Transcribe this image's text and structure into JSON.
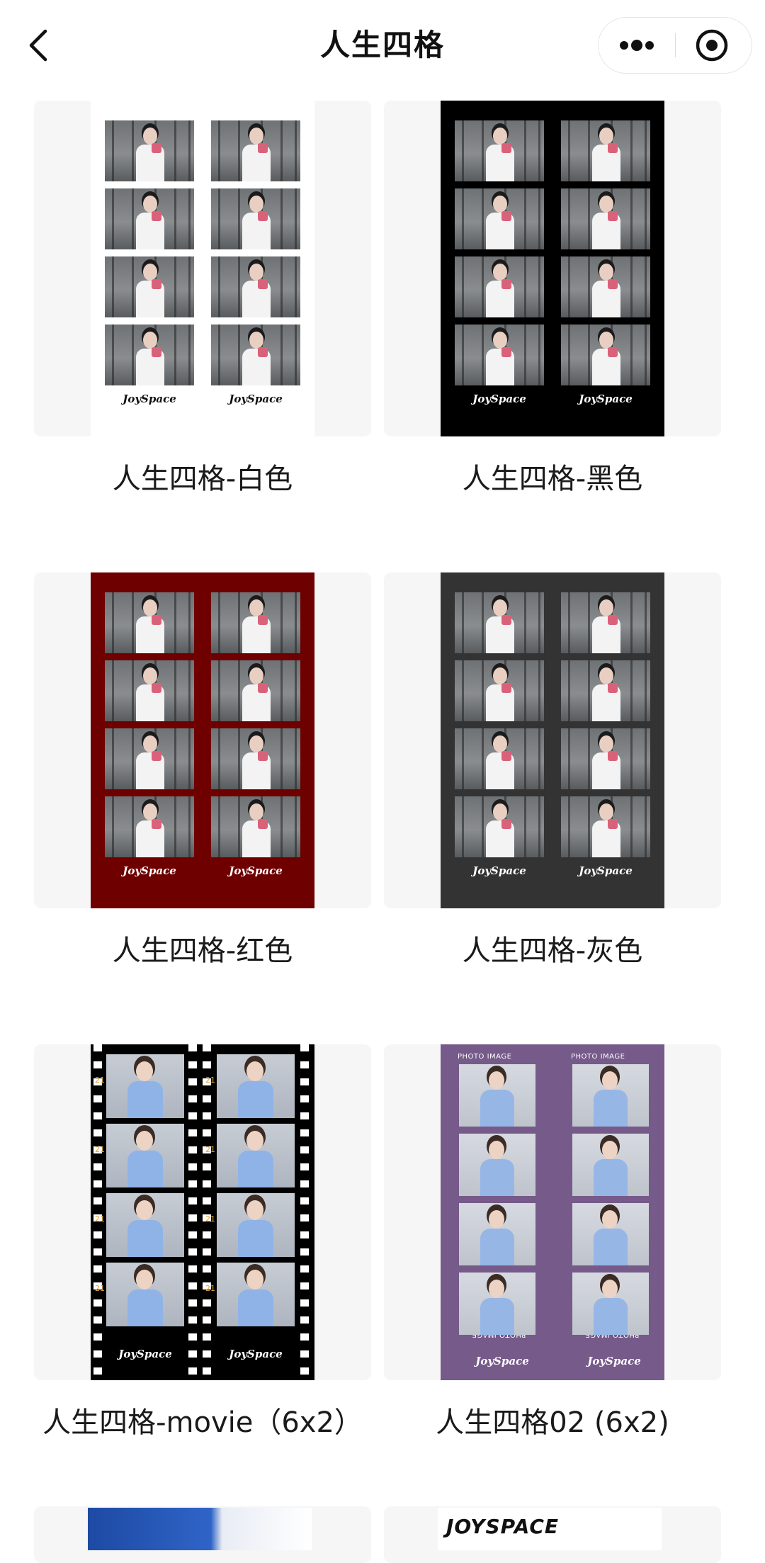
{
  "nav": {
    "title": "人生四格"
  },
  "cards": [
    {
      "label": "人生四格-白色",
      "frame_color": "#ffffff",
      "brand_color": "#111111",
      "brand": "JoySpace"
    },
    {
      "label": "人生四格-黑色",
      "frame_color": "#000000",
      "brand_color": "#ffffff",
      "brand": "JoySpace"
    },
    {
      "label": "人生四格-红色",
      "frame_color": "#6e0000",
      "brand_color": "#ffffff",
      "brand": "JoySpace"
    },
    {
      "label": "人生四格-灰色",
      "frame_color": "#333333",
      "brand_color": "#ffffff",
      "brand": "JoySpace"
    },
    {
      "label": "人生四格-movie（6x2）",
      "frame_color": "#000000",
      "brand_color": "#ffffff",
      "brand": "JoySpace",
      "film_number": "21"
    },
    {
      "label": "人生四格02 (6x2)",
      "frame_color": "#765a8a",
      "brand_color": "#ffffff",
      "brand": "JoySpace",
      "photo_caption": "PHOTO IMAGE"
    }
  ],
  "partial": {
    "right_text": "JOYSPACE"
  }
}
